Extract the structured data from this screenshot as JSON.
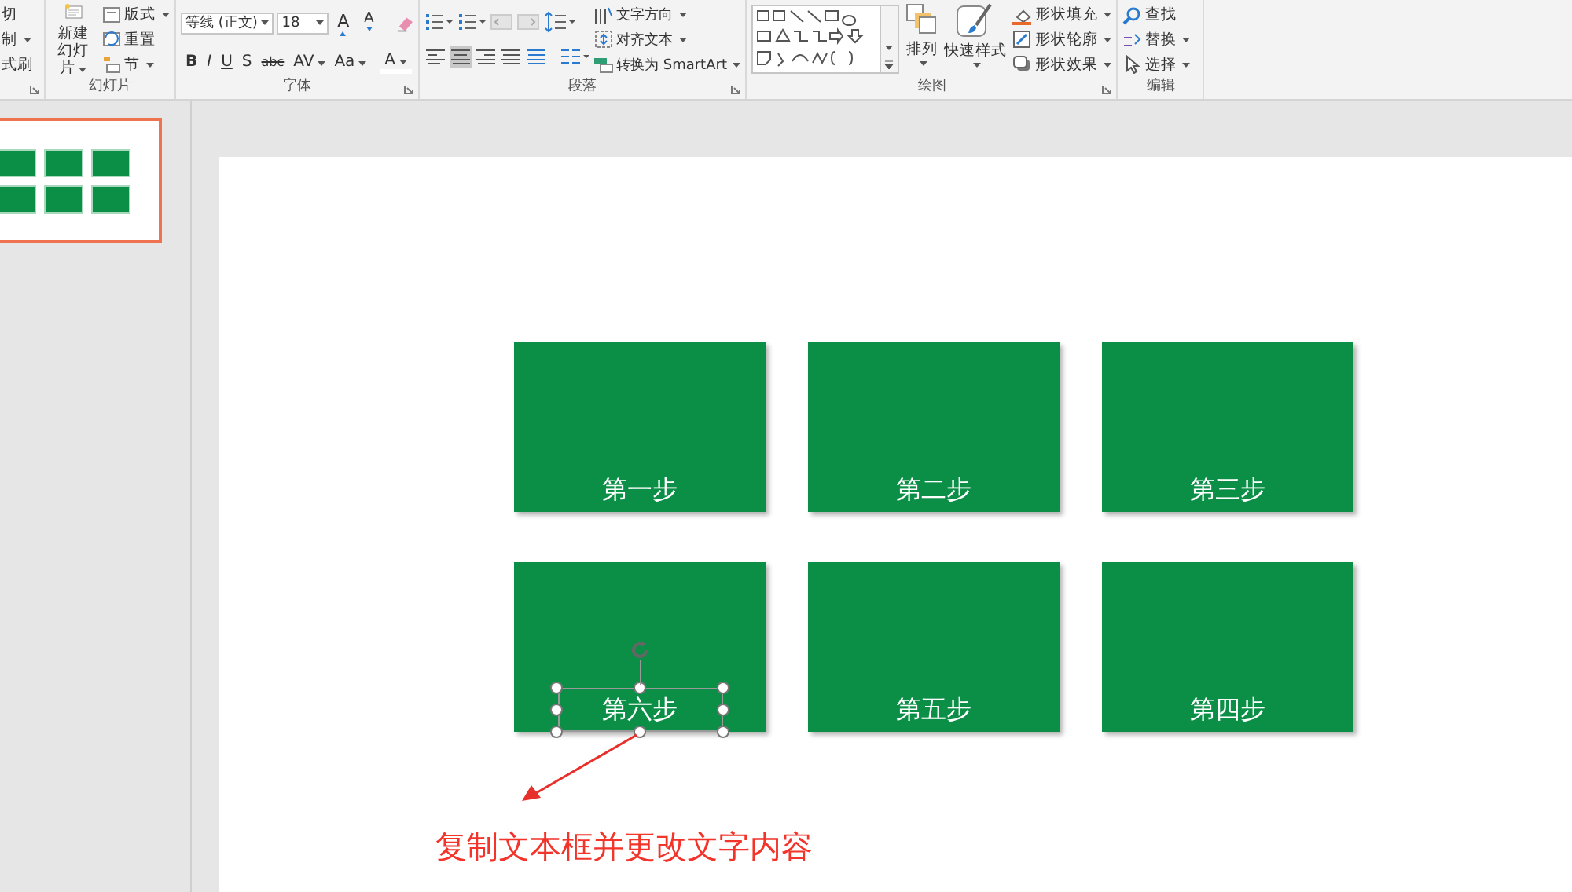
{
  "clipboard_partial": {
    "items": [
      {
        "text": "切",
        "caret": false
      },
      {
        "text": "制",
        "caret": true
      },
      {
        "text": "式刷",
        "caret": false
      }
    ]
  },
  "ribbon_groups": [
    {
      "kind": "slides",
      "label": "幻灯片",
      "new_slide": [
        "新建",
        "幻灯片"
      ],
      "items": [
        {
          "text": "版式",
          "caret": true
        },
        {
          "text": "重置",
          "caret": false
        },
        {
          "text": "节",
          "caret": true
        }
      ]
    },
    {
      "kind": "font",
      "label": "字体",
      "font_name": "等线 (正文)",
      "font_size": "18",
      "size_buttons": [
        "A",
        "A"
      ],
      "format_buttons": [
        "B",
        "I",
        "U",
        "S",
        "abc",
        "AV",
        "Aa",
        "A"
      ]
    },
    {
      "kind": "paragraph",
      "label": "段落",
      "align": [
        {
          "selected": false
        },
        {
          "selected": true
        },
        {
          "selected": false
        },
        {
          "selected": false
        },
        {
          "selected": false
        }
      ],
      "commands": [
        "文字方向",
        "对齐文本",
        "转换为 SmartArt"
      ]
    },
    {
      "kind": "drawing",
      "label": "绘图",
      "arrange": "排列",
      "quick_styles": "快速样式",
      "commands": [
        "形状填充",
        "形状轮廓",
        "形状效果"
      ]
    },
    {
      "kind": "editing",
      "label": "编辑",
      "commands": [
        "查找",
        "替换",
        "选择"
      ]
    }
  ],
  "slides_panel": {
    "thumbnails": [
      {
        "selected": true
      }
    ]
  },
  "slide": {
    "boxes": [
      {
        "label": "第一步",
        "selected": false
      },
      {
        "label": "第二步",
        "selected": false
      },
      {
        "label": "第三步",
        "selected": false
      },
      {
        "label": "第六步",
        "selected": true
      },
      {
        "label": "第五步",
        "selected": false
      },
      {
        "label": "第四步",
        "selected": false
      }
    ],
    "annotation": "复制文本框并更改文字内容"
  }
}
